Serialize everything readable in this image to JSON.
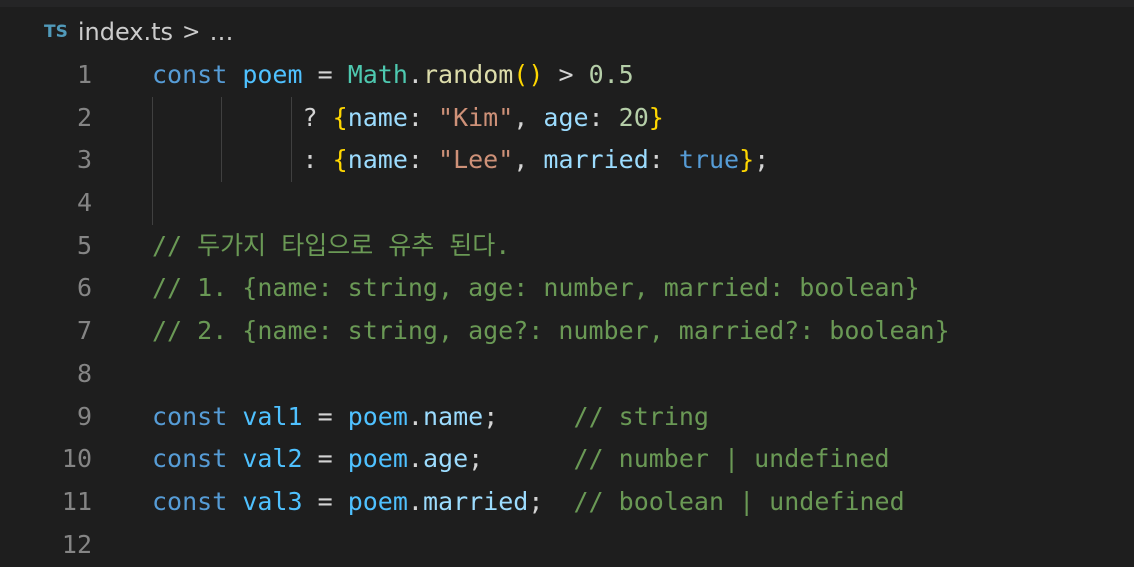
{
  "breadcrumb": {
    "lang_badge": "TS",
    "file": "index.ts",
    "separator": ">",
    "rest": "…"
  },
  "theme": {
    "keyword": "#569cd6",
    "variable": "#4fc1ff",
    "identifier": "#9cdcfe",
    "class": "#4ec9b0",
    "function": "#dcdcaa",
    "number": "#b5cea8",
    "string": "#ce9178",
    "bracket1": "#ffd700",
    "bracket2": "#da70d6",
    "comment": "#6a9955",
    "line_number": "#858585",
    "background": "#1e1e1e"
  },
  "editor": {
    "lines": [
      {
        "num": "1",
        "tokens": [
          [
            "kw",
            "const"
          ],
          [
            "op",
            " "
          ],
          [
            "var",
            "poem"
          ],
          [
            "op",
            " = "
          ],
          [
            "cls",
            "Math"
          ],
          [
            "op",
            "."
          ],
          [
            "fn",
            "random"
          ],
          [
            "br1",
            "()"
          ],
          [
            "op",
            " > "
          ],
          [
            "num",
            "0.5"
          ]
        ]
      },
      {
        "num": "2",
        "tokens": [
          [
            "op",
            "          ? "
          ],
          [
            "br1",
            "{"
          ],
          [
            "id",
            "name"
          ],
          [
            "op",
            ": "
          ],
          [
            "str",
            "\"Kim\""
          ],
          [
            "op",
            ", "
          ],
          [
            "id",
            "age"
          ],
          [
            "op",
            ": "
          ],
          [
            "num",
            "20"
          ],
          [
            "br1",
            "}"
          ]
        ]
      },
      {
        "num": "3",
        "tokens": [
          [
            "op",
            "          : "
          ],
          [
            "br1",
            "{"
          ],
          [
            "id",
            "name"
          ],
          [
            "op",
            ": "
          ],
          [
            "str",
            "\"Lee\""
          ],
          [
            "op",
            ", "
          ],
          [
            "id",
            "married"
          ],
          [
            "op",
            ": "
          ],
          [
            "kw",
            "true"
          ],
          [
            "br1",
            "}"
          ],
          [
            "op",
            ";"
          ]
        ]
      },
      {
        "num": "4",
        "tokens": []
      },
      {
        "num": "5",
        "tokens": [
          [
            "cmt",
            "// 두가지 타입으로 유추 된다."
          ]
        ]
      },
      {
        "num": "6",
        "tokens": [
          [
            "cmt",
            "// 1. {name: string, age: number, married: boolean}"
          ]
        ]
      },
      {
        "num": "7",
        "tokens": [
          [
            "cmt",
            "// 2. {name: string, age?: number, married?: boolean}"
          ]
        ]
      },
      {
        "num": "8",
        "tokens": []
      },
      {
        "num": "9",
        "tokens": [
          [
            "kw",
            "const"
          ],
          [
            "op",
            " "
          ],
          [
            "var",
            "val1"
          ],
          [
            "op",
            " = "
          ],
          [
            "var",
            "poem"
          ],
          [
            "op",
            "."
          ],
          [
            "id",
            "name"
          ],
          [
            "op",
            ";     "
          ],
          [
            "cmt",
            "// string"
          ]
        ]
      },
      {
        "num": "10",
        "tokens": [
          [
            "kw",
            "const"
          ],
          [
            "op",
            " "
          ],
          [
            "var",
            "val2"
          ],
          [
            "op",
            " = "
          ],
          [
            "var",
            "poem"
          ],
          [
            "op",
            "."
          ],
          [
            "id",
            "age"
          ],
          [
            "op",
            ";      "
          ],
          [
            "cmt",
            "// number | undefined"
          ]
        ]
      },
      {
        "num": "11",
        "tokens": [
          [
            "kw",
            "const"
          ],
          [
            "op",
            " "
          ],
          [
            "var",
            "val3"
          ],
          [
            "op",
            " = "
          ],
          [
            "var",
            "poem"
          ],
          [
            "op",
            "."
          ],
          [
            "id",
            "married"
          ],
          [
            "op",
            ";  "
          ],
          [
            "cmt",
            "// boolean | undefined"
          ]
        ]
      },
      {
        "num": "12",
        "tokens": []
      }
    ]
  }
}
